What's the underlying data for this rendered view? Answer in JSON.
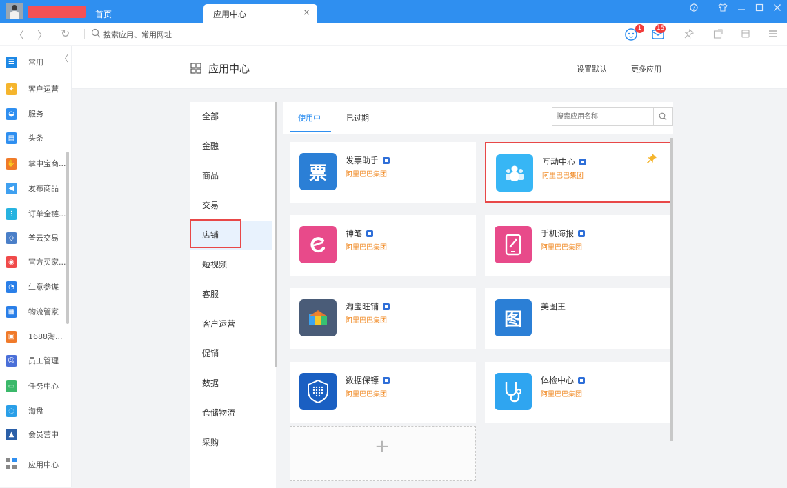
{
  "titlebar": {
    "tab_home": "首页",
    "tab_active": "应用中心",
    "tab_close": "×",
    "controls": [
      "?",
      "shirt",
      "—",
      "□",
      "×"
    ]
  },
  "addressbar": {
    "back": "〈",
    "forward": "〉",
    "refresh": "↻",
    "placeholder": "搜索应用、常用网址",
    "badge_1": "1",
    "badge_2": "15"
  },
  "sidebar": {
    "items": [
      {
        "label": "常用",
        "color": "#1e88e5"
      },
      {
        "label": "客户运营",
        "color": "#f5b52d"
      },
      {
        "label": "服务",
        "color": "#2f8ff0"
      },
      {
        "label": "头条",
        "color": "#2f8ff0"
      },
      {
        "label": "掌中宝商...",
        "color": "#f07a2a"
      },
      {
        "label": "发布商品",
        "color": "#3fa0f0"
      },
      {
        "label": "订单全链...",
        "color": "#27b3e0"
      },
      {
        "label": "普云交易",
        "color": "#4a7fc8"
      },
      {
        "label": "官方买家...",
        "color": "#f04a4a"
      },
      {
        "label": "生意参谋",
        "color": "#2a7fe8"
      },
      {
        "label": "物流管家",
        "color": "#2a7fe8"
      },
      {
        "label": "1688淘...",
        "color": "#f07a2a"
      },
      {
        "label": "员工管理",
        "color": "#4a6fd8"
      },
      {
        "label": "任务中心",
        "color": "#3bb86a"
      },
      {
        "label": "淘盘",
        "color": "#2a9fe8"
      },
      {
        "label": "会员营中",
        "color": "#2a5fa8"
      }
    ],
    "bottom_label": "应用中心"
  },
  "header": {
    "title": "应用中心",
    "set_default": "设置默认",
    "more_apps": "更多应用"
  },
  "categories": [
    "全部",
    "金融",
    "商品",
    "交易",
    "店铺",
    "短视频",
    "客服",
    "客户运营",
    "促销",
    "数据",
    "仓储物流",
    "采购"
  ],
  "active_category": "店铺",
  "subtabs": {
    "in_use": "使用中",
    "expired": "已过期"
  },
  "app_search": {
    "placeholder": "搜索应用名称"
  },
  "apps": [
    {
      "name": "发票助手",
      "vendor": "阿里巴巴集团",
      "official": true,
      "color": "#2b7fd6",
      "icon": "票",
      "highlight": false
    },
    {
      "name": "互动中心",
      "vendor": "阿里巴巴集团",
      "official": true,
      "color": "#37b6f5",
      "icon": "people-icon",
      "highlight": true
    },
    {
      "name": "神笔",
      "vendor": "阿里巴巴集团",
      "official": true,
      "color": "#e84a8a",
      "icon": "pen-icon",
      "highlight": false
    },
    {
      "name": "手机海报",
      "vendor": "阿里巴巴集团",
      "official": true,
      "color": "#e84a8a",
      "icon": "phone-icon",
      "highlight": false
    },
    {
      "name": "淘宝旺铺",
      "vendor": "阿里巴巴集团",
      "official": true,
      "color": "#4a5c78",
      "icon": "shop-icon",
      "highlight": false
    },
    {
      "name": "美图王",
      "vendor": "",
      "official": false,
      "color": "#2b7fd6",
      "icon": "图",
      "highlight": false
    },
    {
      "name": "数据保镖",
      "vendor": "阿里巴巴集团",
      "official": true,
      "color": "#1a5fc2",
      "icon": "shield-icon",
      "highlight": false
    },
    {
      "name": "体检中心",
      "vendor": "阿里巴巴集团",
      "official": true,
      "color": "#2fa5f0",
      "icon": "stethoscope-icon",
      "highlight": false
    }
  ],
  "add_label": "+"
}
